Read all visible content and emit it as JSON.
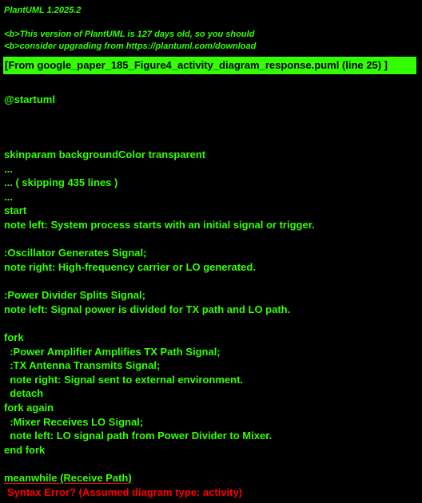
{
  "header": {
    "title": "PlantUML 1.2025.2",
    "warning_line1": "<b>This version of PlantUML is 127 days old, so you should",
    "warning_line2": "<b>consider upgrading from https://plantuml.com/download"
  },
  "banner": {
    "text": "[From google_paper_185_Figure4_activity_diagram_response.puml (line 25) ]"
  },
  "source": {
    "lines": [
      "@startuml",
      "skinparam backgroundColor transparent",
      "...",
      "... ( skipping 435 lines )",
      "...",
      "start",
      "note left: System process starts with an initial signal or trigger.",
      ":Oscillator Generates Signal;",
      "note right: High-frequency carrier or LO generated.",
      ":Power Divider Splits Signal;",
      "note left: Signal power is divided for TX path and LO path.",
      "fork",
      "  :Power Amplifier Amplifies TX Path Signal;",
      "  :TX Antenna Transmits Signal;",
      "  note right: Signal sent to external environment.",
      "  detach",
      "fork again",
      "  :Mixer Receives LO Signal;",
      "  note left: LO signal path from Power Divider to Mixer.",
      "end fork",
      "meanwhile (Receive Path)"
    ]
  },
  "error": {
    "message": "Syntax Error? (Assumed diagram type: activity)"
  },
  "colors": {
    "text": "#33FF02",
    "background": "#000000",
    "banner_bg": "#33FF02",
    "error": "#FF0000"
  }
}
